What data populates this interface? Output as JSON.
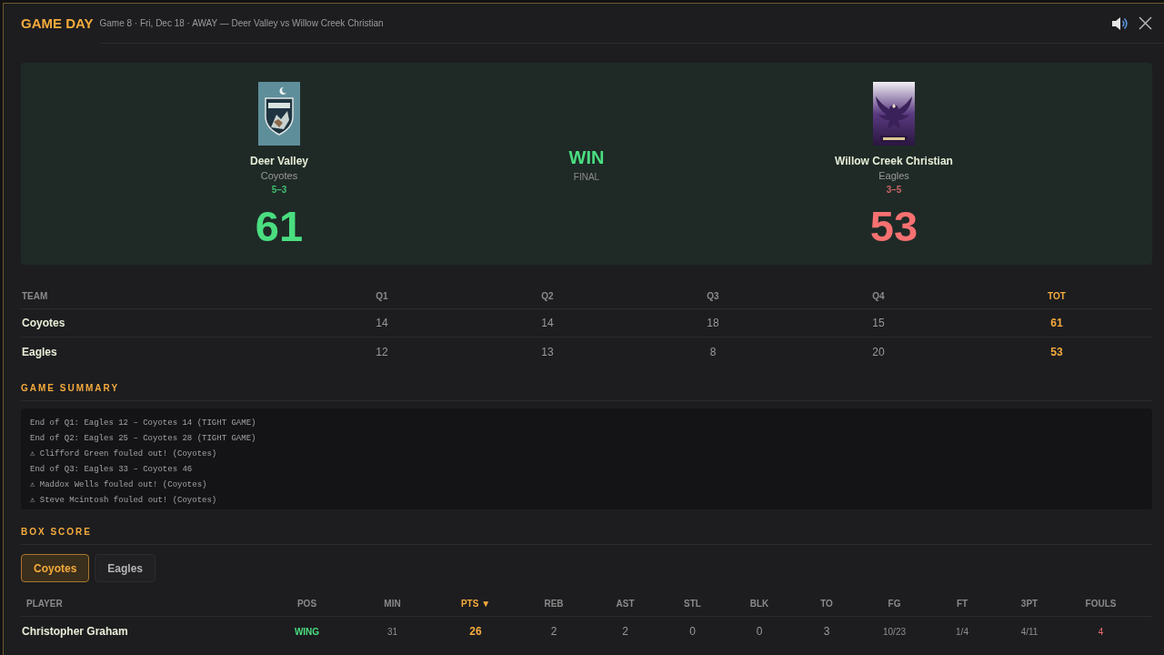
{
  "header": {
    "title": "GAME DAY",
    "subtitle": "Game 8 · Fri, Dec 18 · AWAY — Deer Valley vs Willow Creek Christian"
  },
  "scoreboard": {
    "teams": [
      {
        "kind": "shield",
        "name": "Deer Valley",
        "mascot": "Coyotes",
        "record": "5–3",
        "score": "61",
        "winner": true
      },
      {
        "kind": "eagle",
        "name": "Willow Creek Christian",
        "mascot": "Eagles",
        "record": "3–5",
        "score": "53",
        "winner": false
      }
    ],
    "result": {
      "label": "WIN",
      "status": "FINAL",
      "won": true
    }
  },
  "line_score": {
    "columns": [
      {
        "label": "TEAM",
        "kind": "team"
      },
      {
        "label": "Q1",
        "kind": "quarter"
      },
      {
        "label": "Q2",
        "kind": "quarter"
      },
      {
        "label": "Q3",
        "kind": "quarter"
      },
      {
        "label": "Q4",
        "kind": "quarter"
      },
      {
        "label": "TOT",
        "kind": "total"
      }
    ],
    "rows": [
      {
        "cells": [
          "Coyotes",
          "14",
          "14",
          "18",
          "15",
          "61"
        ]
      },
      {
        "cells": [
          "Eagles",
          "12",
          "13",
          "8",
          "20",
          "53"
        ]
      }
    ]
  },
  "game_summary": {
    "title": "GAME SUMMARY",
    "lines": [
      "End of Q1: Eagles 12 – Coyotes 14 (TIGHT GAME)",
      "End of Q2: Eagles 25 – Coyotes 28 (TIGHT GAME)",
      "⚠ Clifford Green fouled out! (Coyotes)",
      "End of Q3: Eagles 33 – Coyotes 46",
      "⚠ Maddox Wells fouled out! (Coyotes)",
      "⚠ Steve Mcintosh fouled out! (Coyotes)"
    ]
  },
  "box_score": {
    "title": "BOX SCORE",
    "tabs": [
      {
        "label": "Coyotes",
        "selected": true
      },
      {
        "label": "Eagles",
        "selected": false
      }
    ],
    "columns": [
      {
        "label": "PLAYER",
        "kind": "player",
        "sorted": false
      },
      {
        "label": "POS",
        "kind": "position",
        "sorted": false
      },
      {
        "label": "MIN",
        "kind": "minor",
        "sorted": false
      },
      {
        "label": "PTS ▼",
        "kind": "stat",
        "sorted": true
      },
      {
        "label": "REB",
        "kind": "stat",
        "sorted": false
      },
      {
        "label": "AST",
        "kind": "stat",
        "sorted": false
      },
      {
        "label": "STL",
        "kind": "stat",
        "sorted": false
      },
      {
        "label": "BLK",
        "kind": "stat",
        "sorted": false
      },
      {
        "label": "TO",
        "kind": "stat",
        "sorted": false
      },
      {
        "label": "FG",
        "kind": "minor",
        "sorted": false
      },
      {
        "label": "FT",
        "kind": "minor",
        "sorted": false
      },
      {
        "label": "3PT",
        "kind": "minor",
        "sorted": false
      },
      {
        "label": "FOULS",
        "kind": "fouls",
        "sorted": false
      }
    ],
    "rows": [
      {
        "cells": [
          "Christopher Graham",
          "WING",
          "31",
          "26",
          "2",
          "2",
          "0",
          "0",
          "3",
          "10/23",
          "1/4",
          "4/11",
          "4"
        ],
        "foul_trouble": true
      }
    ]
  }
}
